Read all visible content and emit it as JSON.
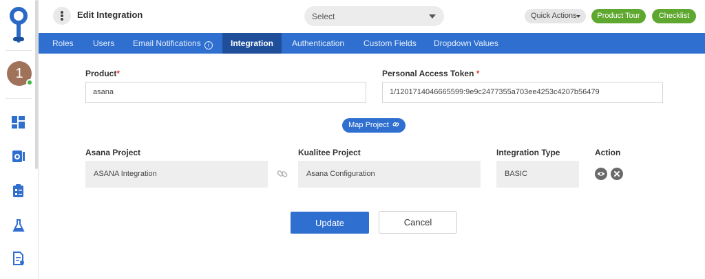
{
  "app": {
    "page_title": "Edit Integration"
  },
  "header": {
    "select_placeholder": "Select",
    "quick_actions_label": "Quick Actions",
    "product_tour_label": "Product Tour",
    "checklist_label": "Checklist"
  },
  "user": {
    "avatar_initial": "1",
    "status": "online"
  },
  "tabs": [
    {
      "label": "Roles",
      "active": false
    },
    {
      "label": "Users",
      "active": false
    },
    {
      "label": "Email Notifications",
      "active": false
    },
    {
      "label": "Integration",
      "active": true
    },
    {
      "label": "Authentication",
      "active": false
    },
    {
      "label": "Custom Fields",
      "active": false
    },
    {
      "label": "Dropdown Values",
      "active": false
    }
  ],
  "form": {
    "product_label": "Product",
    "product_required_mark": "*",
    "product_value": "asana",
    "token_label": "Personal Access Token",
    "token_required_mark": "*",
    "token_value": "1/1201714046665599:9e9c2477355a703ee4253c4207b56479",
    "map_project_label": "Map Project"
  },
  "mapping": {
    "headers": {
      "asana_project": "Asana Project",
      "kualitee_project": "Kualitee Project",
      "integration_type": "Integration Type",
      "action": "Action"
    },
    "row": {
      "asana_project": "ASANA Integration",
      "kualitee_project": "Asana Configuration",
      "integration_type": "BASIC"
    }
  },
  "buttons": {
    "update_label": "Update",
    "cancel_label": "Cancel"
  },
  "colors": {
    "primary": "#2f6fd0",
    "tab_active": "#1f4f9a",
    "green": "#5fa830",
    "required": "#e03b3b"
  }
}
